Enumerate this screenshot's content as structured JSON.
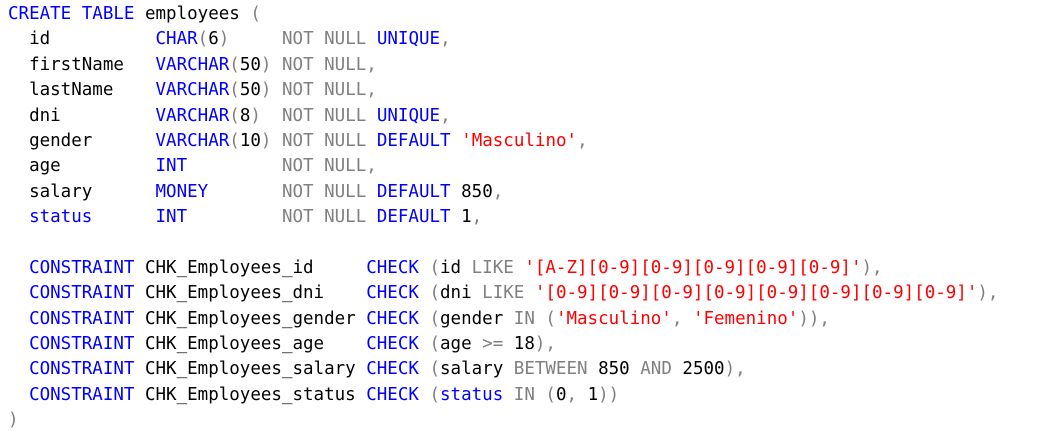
{
  "editor": {
    "colors": {
      "kw": "#0000ff",
      "id": "#000000",
      "str": "#ff0000",
      "gray": "#808080",
      "num": "#000000"
    },
    "lines": [
      [
        [
          "kw",
          "CREATE TABLE"
        ],
        [
          "id",
          " employees "
        ],
        [
          "gray",
          "("
        ]
      ],
      [
        [
          "id",
          "  id          "
        ],
        [
          "kw",
          "CHAR"
        ],
        [
          "gray",
          "("
        ],
        [
          "num",
          "6"
        ],
        [
          "gray",
          ")"
        ],
        [
          "id",
          "     "
        ],
        [
          "gray",
          "NOT NULL"
        ],
        [
          "id",
          " "
        ],
        [
          "kw",
          "UNIQUE"
        ],
        [
          "gray",
          ","
        ]
      ],
      [
        [
          "id",
          "  firstName   "
        ],
        [
          "kw",
          "VARCHAR"
        ],
        [
          "gray",
          "("
        ],
        [
          "num",
          "50"
        ],
        [
          "gray",
          ")"
        ],
        [
          "id",
          " "
        ],
        [
          "gray",
          "NOT NULL,"
        ]
      ],
      [
        [
          "id",
          "  lastName    "
        ],
        [
          "kw",
          "VARCHAR"
        ],
        [
          "gray",
          "("
        ],
        [
          "num",
          "50"
        ],
        [
          "gray",
          ")"
        ],
        [
          "id",
          " "
        ],
        [
          "gray",
          "NOT NULL,"
        ]
      ],
      [
        [
          "id",
          "  dni         "
        ],
        [
          "kw",
          "VARCHAR"
        ],
        [
          "gray",
          "("
        ],
        [
          "num",
          "8"
        ],
        [
          "gray",
          ")"
        ],
        [
          "id",
          "  "
        ],
        [
          "gray",
          "NOT NULL"
        ],
        [
          "id",
          " "
        ],
        [
          "kw",
          "UNIQUE"
        ],
        [
          "gray",
          ","
        ]
      ],
      [
        [
          "id",
          "  gender      "
        ],
        [
          "kw",
          "VARCHAR"
        ],
        [
          "gray",
          "("
        ],
        [
          "num",
          "10"
        ],
        [
          "gray",
          ")"
        ],
        [
          "id",
          " "
        ],
        [
          "gray",
          "NOT NULL"
        ],
        [
          "id",
          " "
        ],
        [
          "kw",
          "DEFAULT"
        ],
        [
          "id",
          " "
        ],
        [
          "str",
          "'Masculino'"
        ],
        [
          "gray",
          ","
        ]
      ],
      [
        [
          "id",
          "  age         "
        ],
        [
          "kw",
          "INT"
        ],
        [
          "id",
          "         "
        ],
        [
          "gray",
          "NOT NULL,"
        ]
      ],
      [
        [
          "id",
          "  salary      "
        ],
        [
          "kw",
          "MONEY"
        ],
        [
          "id",
          "       "
        ],
        [
          "gray",
          "NOT NULL"
        ],
        [
          "id",
          " "
        ],
        [
          "kw",
          "DEFAULT"
        ],
        [
          "id",
          " "
        ],
        [
          "num",
          "850"
        ],
        [
          "gray",
          ","
        ]
      ],
      [
        [
          "id",
          "  "
        ],
        [
          "kw",
          "status"
        ],
        [
          "id",
          "      "
        ],
        [
          "kw",
          "INT"
        ],
        [
          "id",
          "         "
        ],
        [
          "gray",
          "NOT NULL"
        ],
        [
          "id",
          " "
        ],
        [
          "kw",
          "DEFAULT"
        ],
        [
          "id",
          " "
        ],
        [
          "num",
          "1"
        ],
        [
          "gray",
          ","
        ]
      ],
      [
        [
          "id",
          " "
        ]
      ],
      [
        [
          "id",
          "  "
        ],
        [
          "kw",
          "CONSTRAINT"
        ],
        [
          "id",
          " CHK_Employees_id     "
        ],
        [
          "kw",
          "CHECK"
        ],
        [
          "id",
          " "
        ],
        [
          "gray",
          "("
        ],
        [
          "id",
          "id "
        ],
        [
          "gray",
          "LIKE"
        ],
        [
          "id",
          " "
        ],
        [
          "str",
          "'[A-Z][0-9][0-9][0-9][0-9][0-9]'"
        ],
        [
          "gray",
          "),"
        ]
      ],
      [
        [
          "id",
          "  "
        ],
        [
          "kw",
          "CONSTRAINT"
        ],
        [
          "id",
          " CHK_Employees_dni    "
        ],
        [
          "kw",
          "CHECK"
        ],
        [
          "id",
          " "
        ],
        [
          "gray",
          "("
        ],
        [
          "id",
          "dni "
        ],
        [
          "gray",
          "LIKE"
        ],
        [
          "id",
          " "
        ],
        [
          "str",
          "'[0-9][0-9][0-9][0-9][0-9][0-9][0-9][0-9]'"
        ],
        [
          "gray",
          "),"
        ]
      ],
      [
        [
          "id",
          "  "
        ],
        [
          "kw",
          "CONSTRAINT"
        ],
        [
          "id",
          " CHK_Employees_gender "
        ],
        [
          "kw",
          "CHECK"
        ],
        [
          "id",
          " "
        ],
        [
          "gray",
          "("
        ],
        [
          "id",
          "gender "
        ],
        [
          "gray",
          "IN"
        ],
        [
          "id",
          " "
        ],
        [
          "gray",
          "("
        ],
        [
          "str",
          "'Masculino'"
        ],
        [
          "gray",
          ","
        ],
        [
          "id",
          " "
        ],
        [
          "str",
          "'Femenino'"
        ],
        [
          "gray",
          "))"
        ],
        [
          "gray",
          ","
        ]
      ],
      [
        [
          "id",
          "  "
        ],
        [
          "kw",
          "CONSTRAINT"
        ],
        [
          "id",
          " CHK_Employees_age    "
        ],
        [
          "kw",
          "CHECK"
        ],
        [
          "id",
          " "
        ],
        [
          "gray",
          "("
        ],
        [
          "id",
          "age "
        ],
        [
          "gray",
          ">="
        ],
        [
          "id",
          " "
        ],
        [
          "num",
          "18"
        ],
        [
          "gray",
          "),"
        ]
      ],
      [
        [
          "id",
          "  "
        ],
        [
          "kw",
          "CONSTRAINT"
        ],
        [
          "id",
          " CHK_Employees_salary "
        ],
        [
          "kw",
          "CHECK"
        ],
        [
          "id",
          " "
        ],
        [
          "gray",
          "("
        ],
        [
          "id",
          "salary "
        ],
        [
          "gray",
          "BETWEEN"
        ],
        [
          "id",
          " "
        ],
        [
          "num",
          "850"
        ],
        [
          "id",
          " "
        ],
        [
          "gray",
          "AND"
        ],
        [
          "id",
          " "
        ],
        [
          "num",
          "2500"
        ],
        [
          "gray",
          "),"
        ]
      ],
      [
        [
          "id",
          "  "
        ],
        [
          "kw",
          "CONSTRAINT"
        ],
        [
          "id",
          " CHK_Employees_status "
        ],
        [
          "kw",
          "CHECK"
        ],
        [
          "id",
          " "
        ],
        [
          "gray",
          "("
        ],
        [
          "kw",
          "status"
        ],
        [
          "id",
          " "
        ],
        [
          "gray",
          "IN"
        ],
        [
          "id",
          " "
        ],
        [
          "gray",
          "("
        ],
        [
          "num",
          "0"
        ],
        [
          "gray",
          ","
        ],
        [
          "id",
          " "
        ],
        [
          "num",
          "1"
        ],
        [
          "gray",
          "))"
        ]
      ],
      [
        [
          "gray",
          ")"
        ]
      ]
    ]
  }
}
